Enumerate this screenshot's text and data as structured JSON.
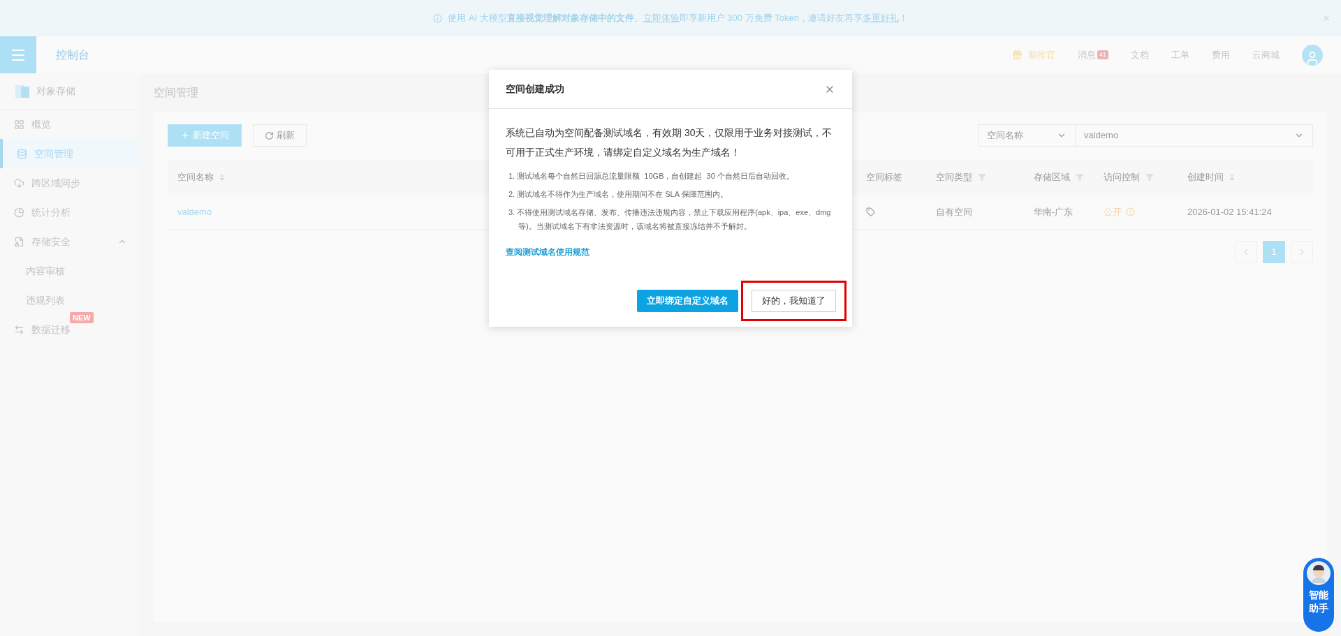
{
  "banner": {
    "segments": [
      {
        "kind": "plain",
        "text": "使用 AI 大模型"
      },
      {
        "kind": "bold",
        "text": "直接视觉理解对象存储中的文件"
      },
      {
        "kind": "plain",
        "text": "。"
      },
      {
        "kind": "link",
        "text": "立即体验"
      },
      {
        "kind": "plain",
        "text": "即享新用户 300 万免费 Token，邀请好友再享"
      },
      {
        "kind": "link",
        "text": "多重好礼"
      },
      {
        "kind": "plain",
        "text": "！"
      }
    ]
  },
  "header": {
    "title": "控制台",
    "nav": [
      {
        "kind": "gift",
        "label": "新推官"
      },
      {
        "kind": "badge",
        "label": "消息",
        "badge": "41"
      },
      {
        "kind": "plain",
        "label": "文档"
      },
      {
        "kind": "plain",
        "label": "工单"
      },
      {
        "kind": "plain",
        "label": "费用"
      },
      {
        "kind": "plain",
        "label": "云商城"
      }
    ]
  },
  "sidebar": {
    "product": "对象存储",
    "items": [
      {
        "kind": "grid",
        "label": "概览",
        "selected": false
      },
      {
        "kind": "database",
        "label": "空间管理",
        "selected": true
      },
      {
        "kind": "cloud",
        "label": "跨区域同步",
        "selected": false
      },
      {
        "kind": "pie",
        "label": "统计分析",
        "selected": false
      },
      {
        "kind": "shield",
        "label": "存储安全",
        "selected": false,
        "expanded": true,
        "children": [
          {
            "label": "内容审核",
            "selected": false
          },
          {
            "label": "违规列表",
            "selected": false
          }
        ]
      },
      {
        "kind": "migrate",
        "label": "数据迁移",
        "selected": false,
        "badge": "NEW"
      }
    ]
  },
  "page": {
    "title": "空间管理",
    "toolbar": {
      "create": "新建空间",
      "refresh": "刷新"
    },
    "filter": {
      "field": "空间名称",
      "value": "valdemo"
    },
    "table": {
      "columns": [
        {
          "label": "空间名称",
          "kind": "sort"
        },
        {
          "label": "空间标签",
          "kind": "plain"
        },
        {
          "label": "空间类型",
          "kind": "filter"
        },
        {
          "label": "存储区域",
          "kind": "filter"
        },
        {
          "label": "访问控制",
          "kind": "filter"
        },
        {
          "label": "创建时间",
          "kind": "sort"
        }
      ],
      "rows": [
        {
          "name": "valdemo",
          "type": "自有空间",
          "region": "华南-广东",
          "access": "公开",
          "created": "2026-01-02 15:41:24"
        }
      ]
    },
    "pagination": {
      "pages": [
        {
          "label": "1",
          "selected": true
        }
      ]
    }
  },
  "dialog": {
    "title": "空间创建成功",
    "message": "系统已自动为空间配备测试域名，有效期 30天，仅限用于业务对接测试，不可用于正式生产环境，请绑定自定义域名为生产域名！",
    "notes": [
      "1. 测试域名每个自然日回源总流量限额  10GB，自创建起  30 个自然日后自动回收。",
      "2. 测试域名不得作为生产域名，使用期间不在 SLA 保障范围内。",
      "3. 不得使用测试域名存储、发布、传播违法违规内容，禁止下载应用程序(apk、ipa、exe、dmg 等)。当测试域名下有非法资源时，该域名将被直接冻结并不予解封。"
    ],
    "link": "查阅测试域名使用规范",
    "primary": "立即绑定自定义域名",
    "secondary": "好的，我知道了"
  },
  "assistant": {
    "label": "智能助手"
  }
}
